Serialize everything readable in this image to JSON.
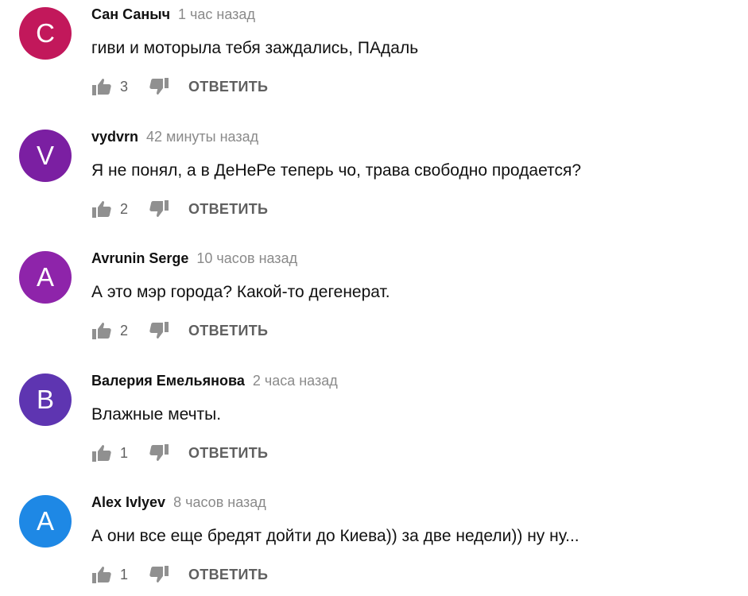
{
  "reply_label": "ОТВЕТИТЬ",
  "icons": {
    "like": "thumb-up-icon",
    "dislike": "thumb-down-icon"
  },
  "comments": [
    {
      "avatar_letter": "С",
      "avatar_color": "#c2185b",
      "author": "Сан Саныч",
      "time": "1 час назад",
      "text": "гиви и моторыла тебя заждались, ПАдаль",
      "likes": "3"
    },
    {
      "avatar_letter": "V",
      "avatar_color": "#7b1fa2",
      "author": "vydvrn",
      "time": "42 минуты назад",
      "text": "Я не понял, а в ДеНеРе теперь чо, трава свободно продается?",
      "likes": "2"
    },
    {
      "avatar_letter": "A",
      "avatar_color": "#8e24aa",
      "author": "Avrunin Serge",
      "time": "10 часов назад",
      "text": "А это мэр города? Какой-то дегенерат.",
      "likes": "2"
    },
    {
      "avatar_letter": "В",
      "avatar_color": "#5e35b1",
      "author": "Валерия Емельянова",
      "time": "2 часа назад",
      "text": "Влажные мечты.",
      "likes": "1"
    },
    {
      "avatar_letter": "A",
      "avatar_color": "#1e88e5",
      "author": "Alex Ivlyev",
      "time": "8 часов назад",
      "text": "А они все еще бредят дойти до Киева)) за две недели)) ну ну...",
      "likes": "1"
    }
  ]
}
